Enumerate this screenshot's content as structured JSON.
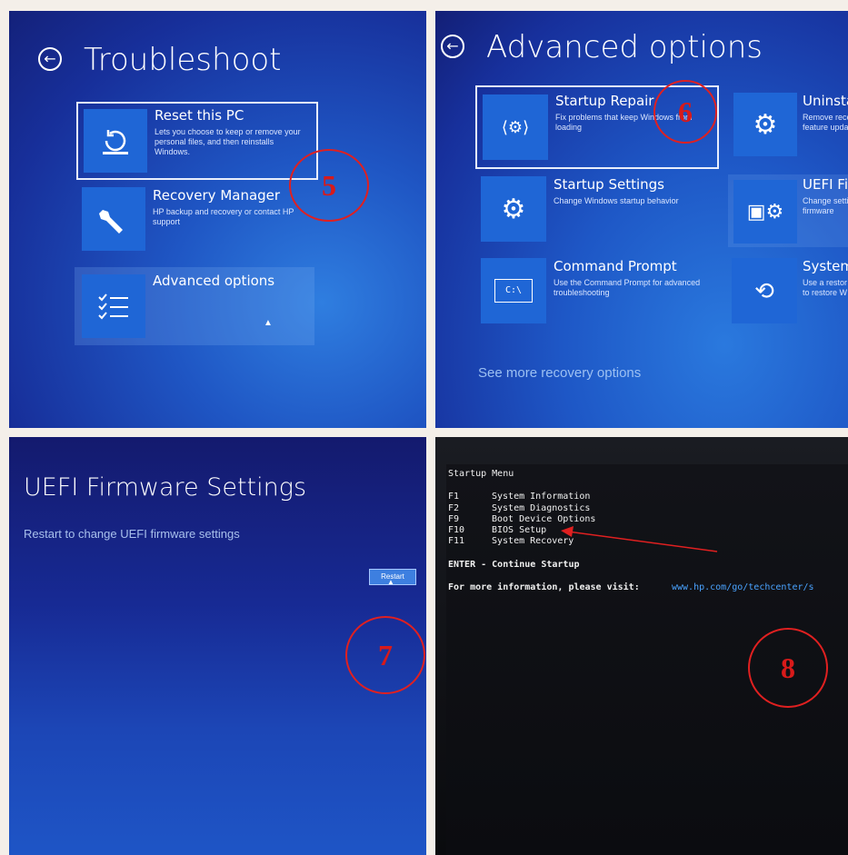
{
  "panel1": {
    "title": "Troubleshoot",
    "options": [
      {
        "title": "Reset this PC",
        "desc": "Lets you choose to keep or remove your personal files, and then reinstalls Windows.",
        "icon": "reset-icon"
      },
      {
        "title": "Recovery Manager",
        "desc": "HP backup and recovery or contact HP support",
        "icon": "wrench-icon"
      },
      {
        "title": "Advanced options",
        "desc": "",
        "icon": "checklist-icon"
      }
    ],
    "step": "5"
  },
  "panel2": {
    "title": "Advanced options",
    "options": [
      {
        "title": "Startup Repair",
        "desc": "Fix problems that keep Windows from loading",
        "icon": "startup-repair-icon"
      },
      {
        "title": "Uninsta",
        "desc": "Remove rece feature upda",
        "icon": "gear-icon"
      },
      {
        "title": "Startup Settings",
        "desc": "Change Windows startup behavior",
        "icon": "gear-icon"
      },
      {
        "title": "UEFI Fir",
        "desc": "Change setti firmware",
        "icon": "firmware-icon"
      },
      {
        "title": "Command Prompt",
        "desc": "Use the Command Prompt for advanced troubleshooting",
        "icon": "command-prompt-icon"
      },
      {
        "title": "System",
        "desc": "Use a restor to restore W",
        "icon": "system-restore-icon"
      }
    ],
    "cmd_icon_text": "C:\\",
    "more_link": "See more recovery options",
    "step": "6"
  },
  "panel3": {
    "title": "UEFI Firmware Settings",
    "subtitle": "Restart to change UEFI firmware settings",
    "restart_label": "Restart",
    "step": "7"
  },
  "panel4": {
    "menu_title": "Startup Menu",
    "items": [
      {
        "key": "F1",
        "label": "System Information"
      },
      {
        "key": "F2",
        "label": "System Diagnostics"
      },
      {
        "key": "F9",
        "label": "Boot Device Options"
      },
      {
        "key": "F10",
        "label": "BIOS Setup"
      },
      {
        "key": "F11",
        "label": "System Recovery"
      }
    ],
    "enter_line": "ENTER - Continue Startup",
    "info_prefix": "For more information, please visit:",
    "info_url": "www.hp.com/go/techcenter/s",
    "step": "8"
  },
  "colors": {
    "annotation": "#e02020",
    "tile_blue": "#1f66d6",
    "link": "#4aa3ff"
  }
}
